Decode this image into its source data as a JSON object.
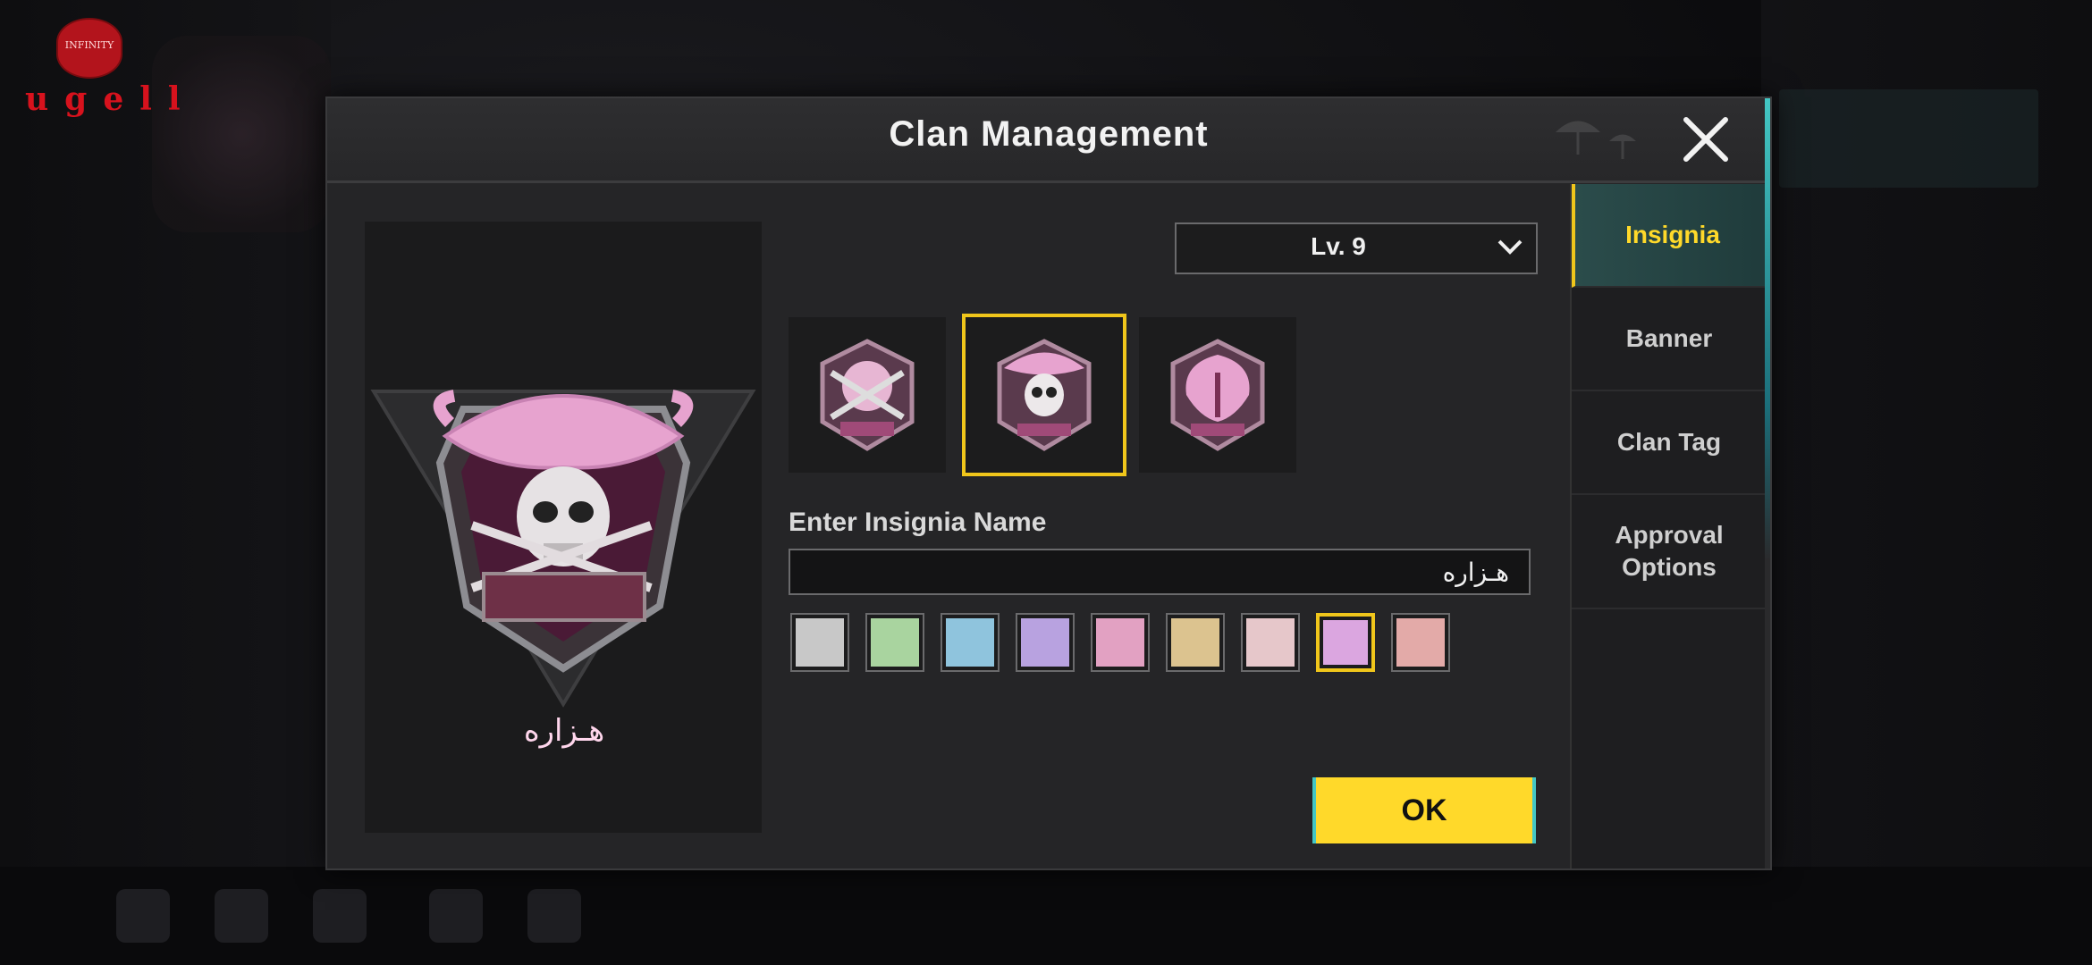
{
  "watermark": {
    "seal_text": "INFINITY",
    "word": "ugell"
  },
  "background": {
    "right_tabs_ghost": [
      "",
      "",
      "",
      ""
    ]
  },
  "dialog": {
    "title": "Clan Management",
    "close_icon": "close-icon"
  },
  "preview": {
    "insignia_name": "هـزاره",
    "insignia_icon": "pirate-skull-insignia"
  },
  "level_select": {
    "value": "Lv. 9"
  },
  "insignia_options": [
    {
      "icon": "crossed-guns-insignia",
      "selected": false
    },
    {
      "icon": "pirate-skull-insignia",
      "selected": true
    },
    {
      "icon": "cobra-insignia",
      "selected": false
    }
  ],
  "name_field": {
    "label": "Enter Insignia Name",
    "value": "هـزاره"
  },
  "colors": [
    {
      "hex": "#c8c8c8",
      "selected": false
    },
    {
      "hex": "#a9d49f",
      "selected": false
    },
    {
      "hex": "#8fc4dd",
      "selected": false
    },
    {
      "hex": "#b8a2e0",
      "selected": false
    },
    {
      "hex": "#e2a1c2",
      "selected": false
    },
    {
      "hex": "#dcc38f",
      "selected": false
    },
    {
      "hex": "#e6c7ca",
      "selected": false
    },
    {
      "hex": "#dba6e0",
      "selected": true
    },
    {
      "hex": "#e3aaa8",
      "selected": false
    }
  ],
  "ok_button": {
    "label": "OK"
  },
  "tabs": [
    {
      "label": "Insignia",
      "active": true
    },
    {
      "label": "Banner",
      "active": false
    },
    {
      "label": "Clan Tag",
      "active": false
    },
    {
      "label": "Approval Options",
      "active": false
    }
  ],
  "accent_color": "#ffd92a"
}
